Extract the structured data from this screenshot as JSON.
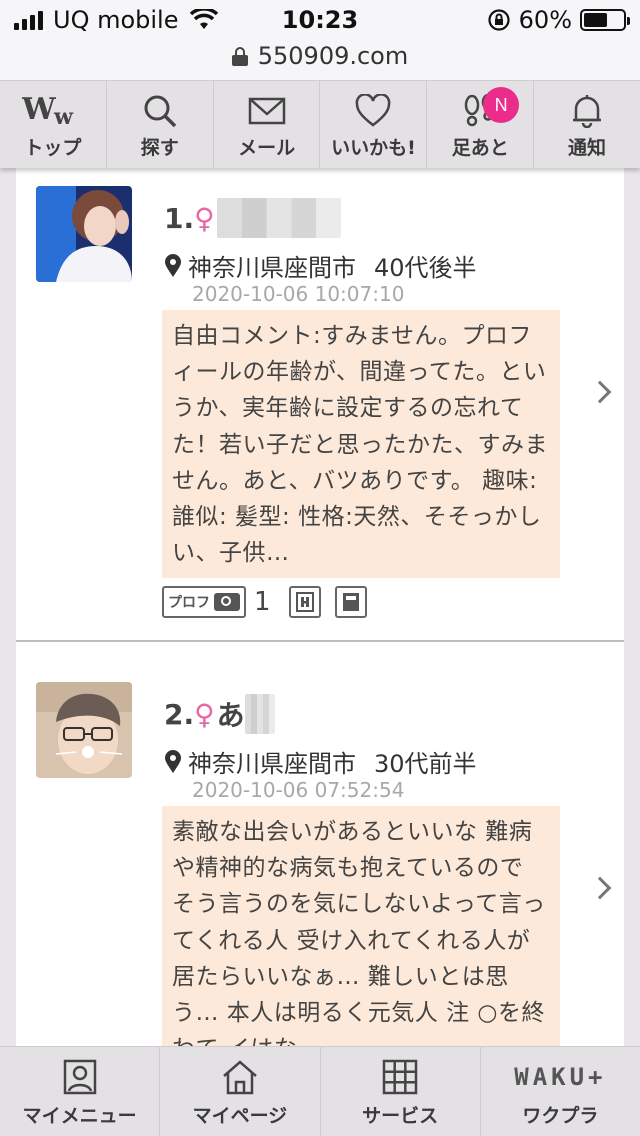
{
  "status_bar": {
    "carrier": "UQ mobile",
    "time": "10:23",
    "battery": "60%",
    "battery_level": 0.6
  },
  "browser": {
    "url": "550909.com"
  },
  "top_nav": {
    "items": [
      {
        "label": "トップ",
        "icon": "ww-logo-icon"
      },
      {
        "label": "探す",
        "icon": "search-icon"
      },
      {
        "label": "メール",
        "icon": "mail-icon"
      },
      {
        "label": "いいかも!",
        "icon": "heart-icon"
      },
      {
        "label": "足あと",
        "icon": "footprints-icon",
        "badge": "N"
      },
      {
        "label": "通知",
        "icon": "bell-icon"
      }
    ]
  },
  "profiles": [
    {
      "rank": "1.",
      "gender_symbol": "♀",
      "name": "",
      "location": "神奈川県座間市",
      "age": "40代後半",
      "datetime": "2020-10-06 10:07:10",
      "comment": "自由コメント:すみません。プロフィールの年齢が、間違ってた。というか、実年齢に設定するの忘れてた！若い子だと思ったかた、すみません。あと、バツありです。 趣味: 誰似: 髪型: 性格:天然、そそっかしい、子供…",
      "prof_label": "プロフ",
      "photo_count": "1"
    },
    {
      "rank": "2.",
      "gender_symbol": "♀",
      "name": "あ",
      "location": "神奈川県座間市",
      "age": "30代前半",
      "datetime": "2020-10-06 07:52:54",
      "comment": "素敵な出会いがあるといいな 難病や精神的な病気も抱えているので そう言うのを気にしないよって言ってくれる人 受け入れてくれる人が居たらいいなぁ… 難しいとは思う… 本人は明るく元気人 注 ○を終わて イはな"
    }
  ],
  "bottom_nav": {
    "items": [
      {
        "label": "マイメニュー",
        "icon": "person-card-icon"
      },
      {
        "label": "マイページ",
        "icon": "home-icon"
      },
      {
        "label": "サービス",
        "icon": "grid-icon"
      },
      {
        "label": "ワクプラ",
        "logo": "WAKU+"
      }
    ]
  },
  "colors": {
    "accent_pink": "#ec2c8a",
    "female_symbol": "#e66aa3",
    "comment_bg": "#fde9d9",
    "nav_bg": "#e4e1e5"
  }
}
